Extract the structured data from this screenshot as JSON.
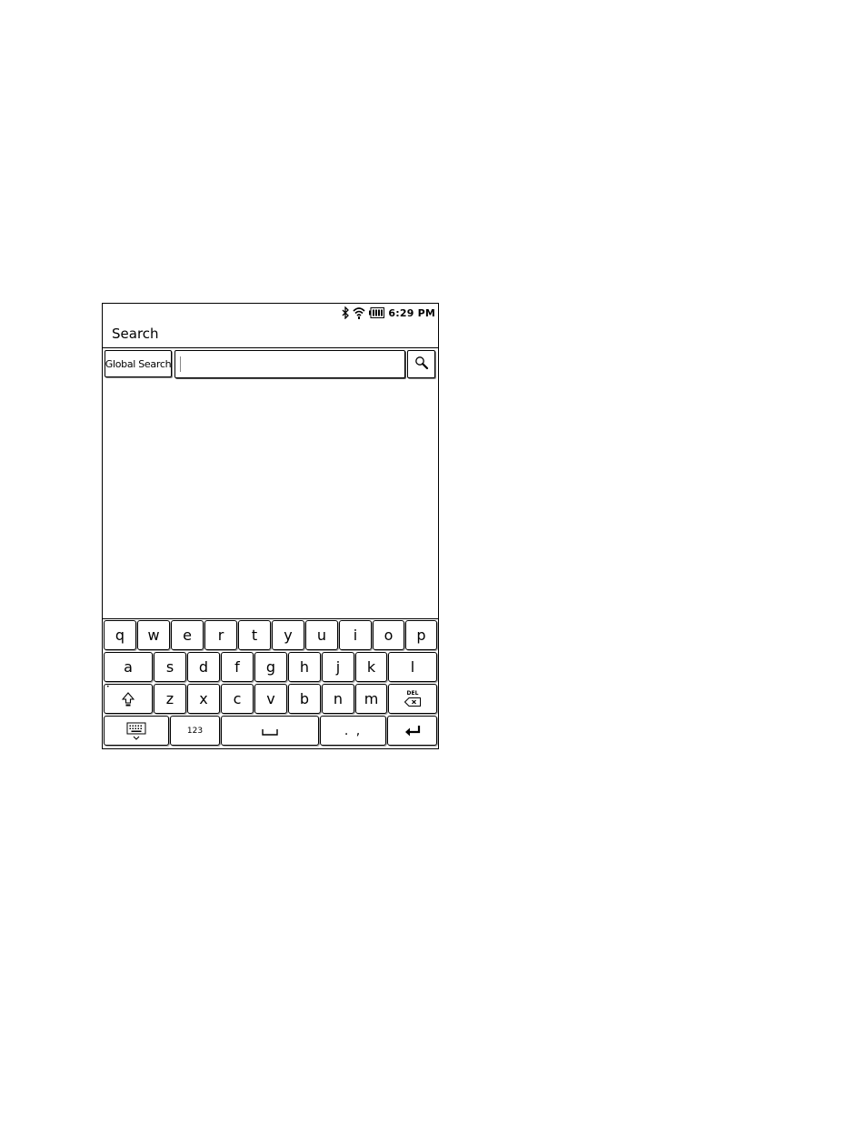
{
  "status_bar": {
    "time": "6:29 PM",
    "icons": [
      "bluetooth-icon",
      "wifi-icon",
      "battery-icon"
    ]
  },
  "header": {
    "title": "Search"
  },
  "search": {
    "scope_label": "Global Search",
    "query_value": "",
    "submit_icon": "magnifier-icon"
  },
  "keyboard": {
    "row1": [
      "q",
      "w",
      "e",
      "r",
      "t",
      "y",
      "u",
      "i",
      "o",
      "p"
    ],
    "row2": [
      "a",
      "s",
      "d",
      "f",
      "g",
      "h",
      "j",
      "k",
      "l"
    ],
    "row3": [
      "z",
      "x",
      "c",
      "v",
      "b",
      "n",
      "m"
    ],
    "shift_icon": "shift-icon",
    "delete_label": "DEL",
    "hide_keyboard_icon": "keyboard-hide-icon",
    "numbers_label": "123",
    "space_icon": "space-icon",
    "punct_label": ". ,",
    "enter_icon": "enter-icon"
  }
}
